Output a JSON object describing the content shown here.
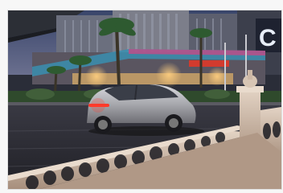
{
  "photo": {
    "visible_signage": "C"
  },
  "colors": {
    "frame": "#f7f7f7",
    "sky_dusk": "#4a5a7a",
    "road": "#2b2b33",
    "car_body": "#b8b8bc",
    "tail_light": "#ff3a2a",
    "balustrade": "#cdb8a6"
  }
}
